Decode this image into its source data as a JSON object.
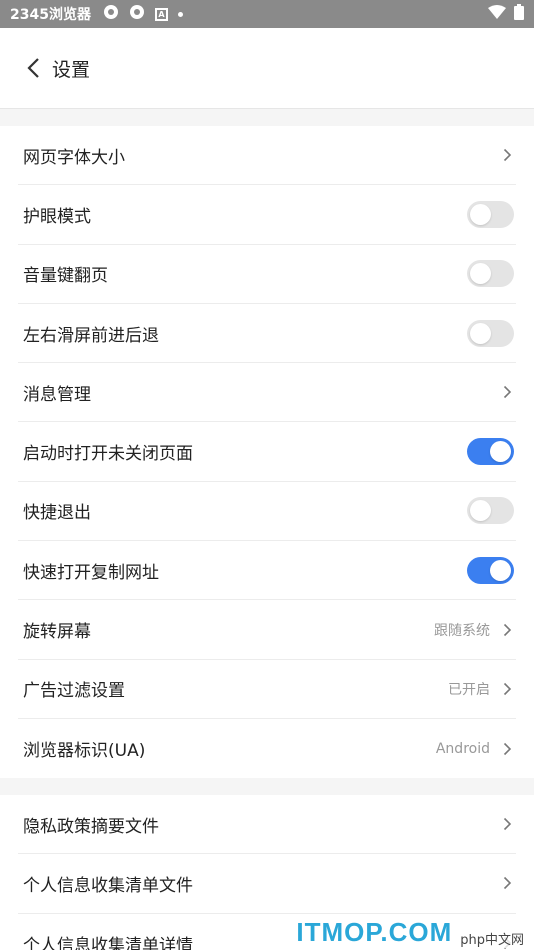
{
  "statusbar": {
    "app_name": "2345浏览器",
    "badge_letter": "A"
  },
  "header": {
    "title": "设置"
  },
  "settings_group_1": [
    {
      "label": "网页字体大小",
      "type": "arrow",
      "value": ""
    },
    {
      "label": "护眼模式",
      "type": "toggle",
      "on": false
    },
    {
      "label": "音量键翻页",
      "type": "toggle",
      "on": false
    },
    {
      "label": "左右滑屏前进后退",
      "type": "toggle",
      "on": false
    },
    {
      "label": "消息管理",
      "type": "arrow",
      "value": ""
    },
    {
      "label": "启动时打开未关闭页面",
      "type": "toggle",
      "on": true
    },
    {
      "label": "快捷退出",
      "type": "toggle",
      "on": false
    },
    {
      "label": "快速打开复制网址",
      "type": "toggle",
      "on": true
    },
    {
      "label": "旋转屏幕",
      "type": "arrow",
      "value": "跟随系统"
    },
    {
      "label": "广告过滤设置",
      "type": "arrow",
      "value": "已开启"
    },
    {
      "label": "浏览器标识(UA)",
      "type": "arrow",
      "value": "Android"
    }
  ],
  "settings_group_2": [
    {
      "label": "隐私政策摘要文件",
      "type": "arrow",
      "value": ""
    },
    {
      "label": "个人信息收集清单文件",
      "type": "arrow",
      "value": ""
    },
    {
      "label": "个人信息收集清单详情",
      "type": "arrow",
      "value": ""
    }
  ],
  "watermark": {
    "main": "ITMOP.COM",
    "sub": "php中文网"
  },
  "colors": {
    "toggle_on": "#3b7ff0",
    "toggle_off": "#e4e4e4",
    "statusbar": "#8a8a8a"
  }
}
